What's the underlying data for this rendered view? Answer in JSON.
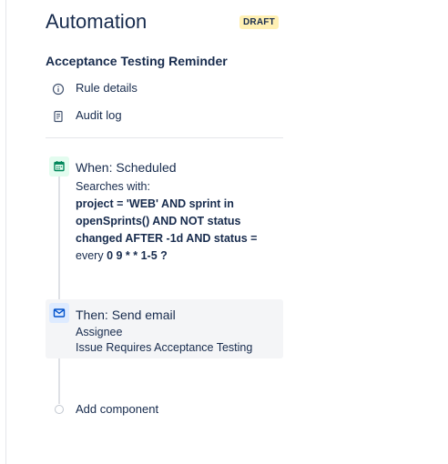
{
  "header": {
    "title": "Automation",
    "badge": "DRAFT"
  },
  "rule": {
    "name": "Acceptance Testing Reminder"
  },
  "nav": [
    {
      "label": "Rule details",
      "icon": "info-icon"
    },
    {
      "label": "Audit log",
      "icon": "document-icon"
    }
  ],
  "trigger": {
    "title": "When: Scheduled",
    "searches_label": "Searches with:",
    "jql": "project = 'WEB' AND sprint in openSprints() AND NOT status changed AFTER -1d AND status =",
    "every_label": "every",
    "cron": "0 9 * * 1-5 ?",
    "icon": "calendar-icon",
    "color": "#00875a"
  },
  "action": {
    "title": "Then: Send email",
    "recipient": "Assignee",
    "subject": "Issue Requires Acceptance Testing",
    "icon": "mail-icon",
    "color": "#0052cc"
  },
  "add_component": {
    "label": "Add component"
  },
  "colors": {
    "badge_bg": "#fff0b3",
    "text": "#172b4d",
    "panel_bg": "#f4f5f7"
  }
}
